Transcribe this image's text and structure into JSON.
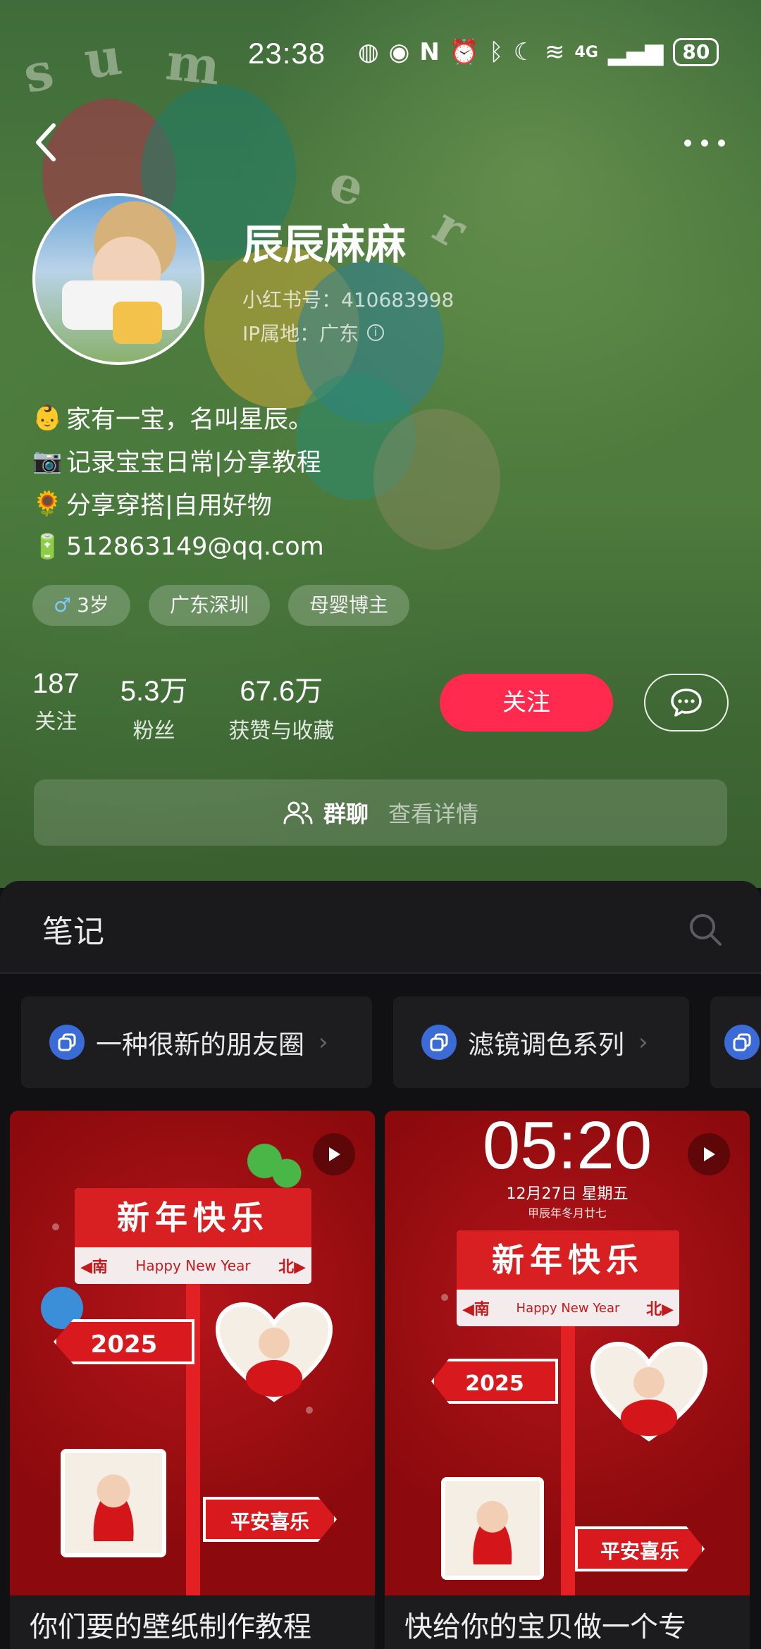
{
  "status_bar": {
    "time": "23:38",
    "network": "4G",
    "battery": "80"
  },
  "profile": {
    "nickname": "辰辰麻麻",
    "red_id": "小红书号：410683998",
    "ip": "IP属地：广东",
    "bio": [
      {
        "emoji": "👶",
        "text": "家有一宝，名叫星辰。"
      },
      {
        "emoji": "📷",
        "text": "记录宝宝日常|分享教程"
      },
      {
        "emoji": "🌻",
        "text": "分享穿搭|自用好物"
      },
      {
        "emoji": "🔋",
        "text": "512863149@qq.com"
      }
    ],
    "tags": [
      {
        "icon": "♂",
        "text": "3岁"
      },
      {
        "text": "广东深圳"
      },
      {
        "text": "母婴博主"
      }
    ],
    "stats": [
      {
        "value": "187",
        "label": "关注"
      },
      {
        "value": "5.3万",
        "label": "粉丝"
      },
      {
        "value": "67.6万",
        "label": "获赞与收藏"
      }
    ],
    "follow_label": "关注",
    "group": {
      "label": "群聊",
      "sub": "查看详情"
    }
  },
  "notes": {
    "tab_label": "笔记",
    "collections": [
      {
        "label": "一种很新的朋友圈"
      },
      {
        "label": "滤镜调色系列"
      }
    ],
    "cards": [
      {
        "caption": "你们要的壁纸制作教程",
        "sign_title": "新年快乐",
        "sign_left": "◀南",
        "sign_mid": "Happy New Year",
        "sign_right": "北▶",
        "year": "2025",
        "bottom_sign": "平安喜乐"
      },
      {
        "caption": "快给你的宝贝做一个专",
        "clock_time": "05:20",
        "clock_date": "12月27日  星期五",
        "clock_lunar": "甲辰年冬月廿七",
        "sign_title": "新年快乐",
        "sign_left": "◀南",
        "sign_mid": "Happy New Year",
        "sign_right": "北▶",
        "year": "2025",
        "bottom_sign": "平安喜乐"
      }
    ]
  },
  "colors": {
    "accent": "#ff2a4d",
    "panel_bg": "#111113",
    "collection_icon": "#3b6bd6",
    "card_red": "#8b0d0f"
  }
}
